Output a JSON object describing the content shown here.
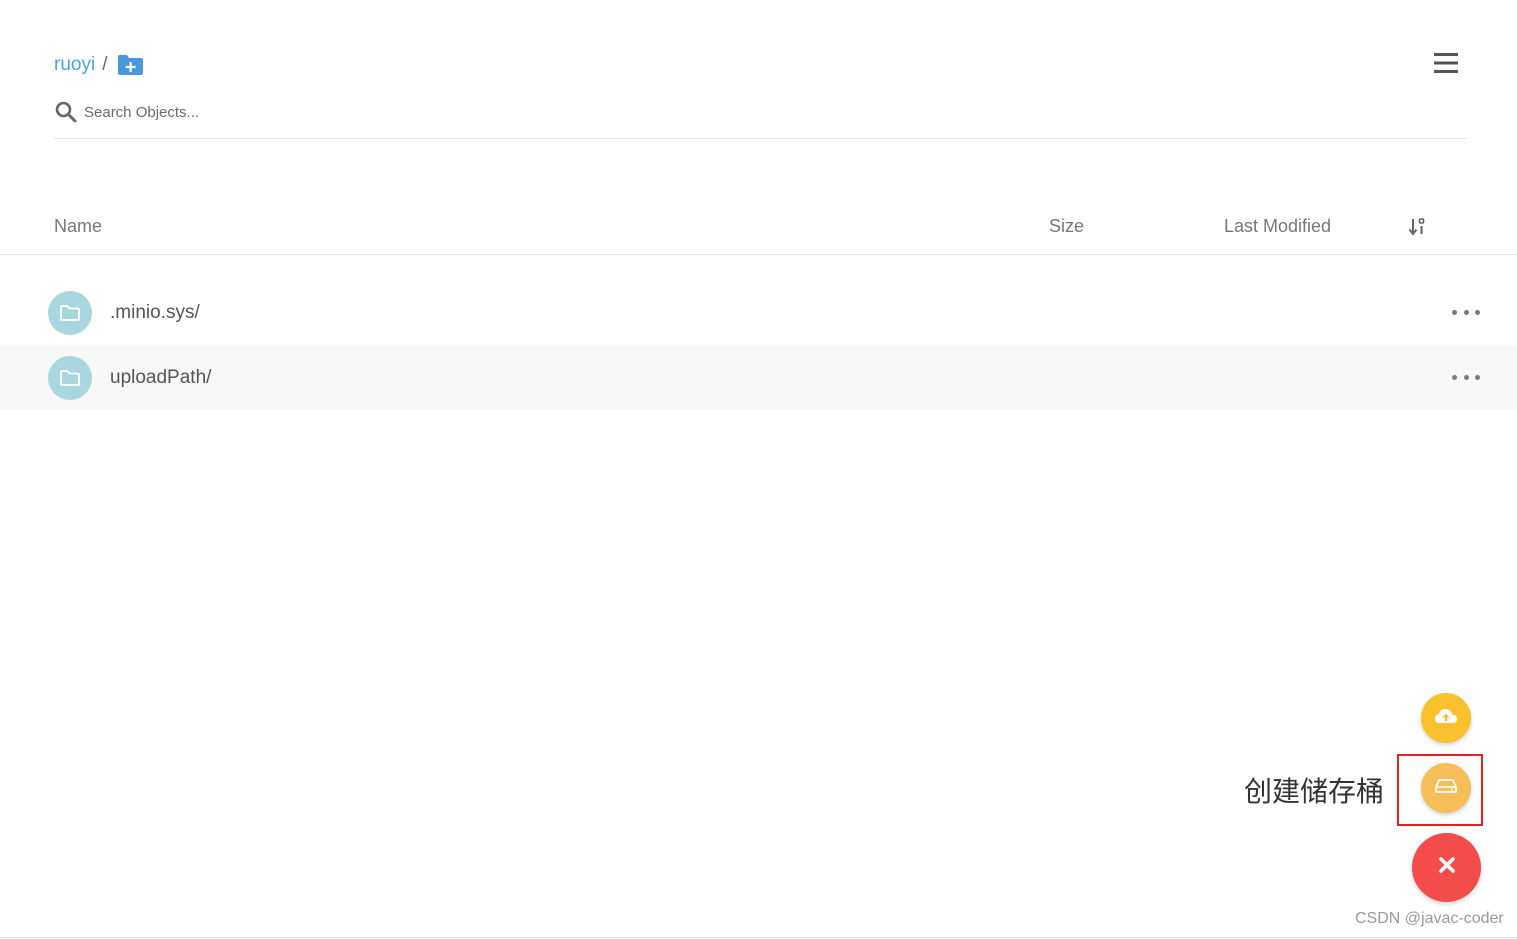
{
  "breadcrumb": {
    "bucket": "ruoyi",
    "separator": "/"
  },
  "search": {
    "placeholder": "Search Objects..."
  },
  "table": {
    "columns": {
      "name": "Name",
      "size": "Size",
      "last_modified": "Last Modified"
    },
    "rows": [
      {
        "name": ".minio.sys/",
        "icon": "folder-icon"
      },
      {
        "name": "uploadPath/",
        "icon": "folder-icon"
      }
    ]
  },
  "fab": {
    "create_bucket_label": "创建储存桶",
    "upload_icon": "cloud-upload-icon",
    "bucket_icon": "hard-drive-icon",
    "close_icon": "close-icon"
  },
  "watermark": "CSDN @javac-coder",
  "colors": {
    "link": "#46a6de",
    "folder_circle": "#a9d6df",
    "fab_upload": "#fbc02d",
    "fab_bucket": "#f5be58",
    "fab_close": "#f44b4b",
    "highlight": "#e8201f"
  }
}
